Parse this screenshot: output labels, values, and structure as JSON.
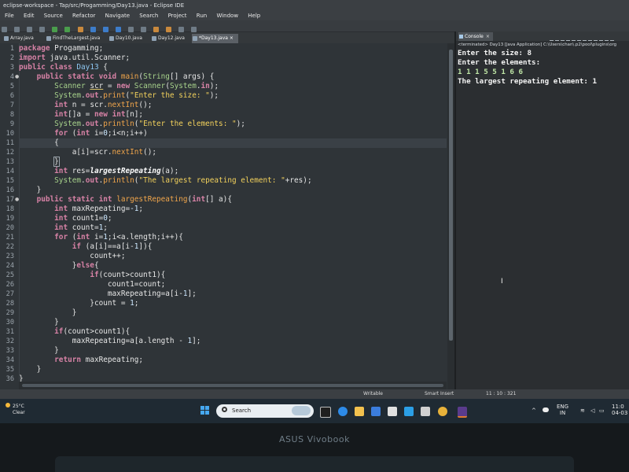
{
  "window": {
    "title": "eclipse-workspace - Tap/src/Progamming/Day13.java - Eclipse IDE"
  },
  "menu": [
    "File",
    "Edit",
    "Source",
    "Refactor",
    "Navigate",
    "Search",
    "Project",
    "Run",
    "Window",
    "Help"
  ],
  "editor_tabs": [
    {
      "label": "Array.java",
      "active": false
    },
    {
      "label": "FindTheLargest.java",
      "active": false
    },
    {
      "label": "Day10.java",
      "active": false
    },
    {
      "label": "Day12.java",
      "active": false
    },
    {
      "label": "*Day13.java",
      "active": true
    }
  ],
  "tab_close_glyph": "×",
  "code": {
    "line_numbers": [
      "1",
      "2",
      "3",
      "4",
      "5",
      "6",
      "7",
      "8",
      "9",
      "10",
      "11",
      "12",
      "13",
      "14",
      "15",
      "16",
      "17",
      "18",
      "19",
      "20",
      "21",
      "22",
      "23",
      "24",
      "25",
      "26",
      "27",
      "28",
      "29",
      "30",
      "31",
      "32",
      "33",
      "34",
      "35",
      "36"
    ],
    "fold_markers": {
      "4": "●",
      "17": "●"
    },
    "current_line": 11
  },
  "console": {
    "tab_label": "Console",
    "close_glyph": "×",
    "status_line": "<terminated> Day13 [Java Application] C:\\Users\\chan\\.p2\\pool\\plugins\\org",
    "output": [
      {
        "text": "Enter the size: 8",
        "kind": "out"
      },
      {
        "text": "Enter the elements:",
        "kind": "out"
      },
      {
        "text": "1 1 1 5 5 1 6 6",
        "kind": "in"
      },
      {
        "text": "The largest repeating element: 1",
        "kind": "out"
      }
    ],
    "text_cursor": "I"
  },
  "status_bar": {
    "writable": "Writable",
    "insert_mode": "Smart Insert",
    "position": "11 : 10 : 321"
  },
  "taskbar": {
    "weather_temp": "25°C",
    "weather_desc": "Clear",
    "search_label": "Search",
    "lang_top": "ENG",
    "lang_bottom": "IN",
    "time": "11:0",
    "date": "04-03"
  },
  "device_brand": "ASUS Vivobook",
  "colors": {
    "editor_bg": "#2f3438",
    "keyword": "#d782a6",
    "string": "#f2d15c",
    "type": "#a7d28b",
    "method": "#f0a54b"
  }
}
